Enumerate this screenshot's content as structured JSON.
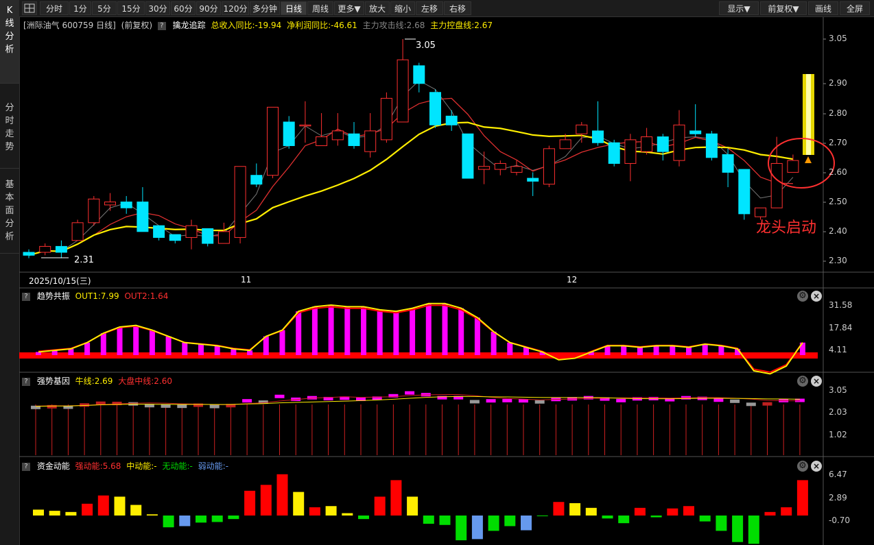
{
  "sidebar": {
    "tabs": [
      "K\n线\n分\n析",
      "分\n时\n走\n势",
      "基\n本\n面\n分\n析"
    ]
  },
  "toolbar": {
    "left": [
      "分时",
      "1分",
      "5分",
      "15分",
      "30分",
      "60分",
      "90分",
      "120分",
      "多分钟",
      "日线",
      "周线",
      "更多▼",
      "放大",
      "缩小",
      "左移",
      "右移"
    ],
    "right": [
      "显示▼",
      "前复权▼",
      "画线",
      "全屏"
    ],
    "active": "日线"
  },
  "main": {
    "stock": "[洲际油气 600759 日线]",
    "adjust": "(前复权)",
    "indicator": "擒龙追踪",
    "rev": "总收入同比:-19.94",
    "profit": "净利润同比:-46.61",
    "attack": "主力攻击线:2.68",
    "control": "主力控盘线:2.67",
    "y_labels": [
      "3.05",
      "2.90",
      "2.80",
      "2.70",
      "2.60",
      "2.50",
      "2.40",
      "2.30"
    ],
    "x_labels": [
      "2025/10/15(三)",
      "11",
      "12"
    ],
    "high_label": "3.05",
    "low_label": "2.31",
    "annotation": "龙头启动"
  },
  "trend": {
    "name": "趋势共振",
    "out1": "OUT1:7.99",
    "out2": "OUT2:1.64",
    "y_labels": [
      "31.58",
      "17.84",
      "4.11"
    ]
  },
  "gene": {
    "name": "强势基因",
    "bull": "牛线:2.69",
    "market": "大盘中线:2.60",
    "y_labels": [
      "3.05",
      "2.03",
      "1.02"
    ]
  },
  "fund": {
    "name": "资金动能",
    "strong": "强动能:5.68",
    "mid": "中动能:-",
    "none": "无动能:-",
    "weak": "弱动能:-",
    "y_labels": [
      "6.47",
      "2.89",
      "-0.70"
    ]
  },
  "colors": {
    "up": "#ff3030",
    "down": "#00e5ff",
    "ma_fast": "#e03030",
    "ma_slow": "#ffee00",
    "magenta": "#ff00ff",
    "red": "#ff0000",
    "yellow": "#ffee00",
    "green": "#00dd00",
    "blue": "#6699ee"
  },
  "chart_data": {
    "type": "candlestick",
    "ylim": [
      2.28,
      3.09
    ],
    "candles": [
      [
        2.33,
        2.32,
        2.34,
        2.31
      ],
      [
        2.33,
        2.35,
        2.36,
        2.32
      ],
      [
        2.35,
        2.33,
        2.37,
        2.31
      ],
      [
        2.37,
        2.43,
        2.44,
        2.37
      ],
      [
        2.43,
        2.51,
        2.52,
        2.42
      ],
      [
        2.49,
        2.5,
        2.53,
        2.47
      ],
      [
        2.5,
        2.48,
        2.52,
        2.46
      ],
      [
        2.5,
        2.4,
        2.55,
        2.4
      ],
      [
        2.42,
        2.38,
        2.42,
        2.37
      ],
      [
        2.39,
        2.37,
        2.39,
        2.36
      ],
      [
        2.38,
        2.42,
        2.44,
        2.34
      ],
      [
        2.41,
        2.36,
        2.41,
        2.35
      ],
      [
        2.36,
        2.4,
        2.43,
        2.36
      ],
      [
        2.38,
        2.62,
        2.62,
        2.36
      ],
      [
        2.59,
        2.56,
        2.63,
        2.55
      ],
      [
        2.59,
        2.82,
        2.82,
        2.58
      ],
      [
        2.77,
        2.69,
        2.79,
        2.68
      ],
      [
        2.76,
        2.76,
        2.84,
        2.7
      ],
      [
        2.69,
        2.72,
        2.8,
        2.69
      ],
      [
        2.71,
        2.74,
        2.8,
        2.69
      ],
      [
        2.73,
        2.69,
        2.77,
        2.68
      ],
      [
        2.67,
        2.74,
        2.8,
        2.65
      ],
      [
        2.71,
        2.85,
        2.87,
        2.7
      ],
      [
        2.77,
        2.98,
        3.05,
        2.77
      ],
      [
        2.96,
        2.9,
        2.97,
        2.87
      ],
      [
        2.87,
        2.76,
        2.88,
        2.75
      ],
      [
        2.79,
        2.76,
        2.81,
        2.74
      ],
      [
        2.73,
        2.58,
        2.73,
        2.58
      ],
      [
        2.61,
        2.62,
        2.67,
        2.56
      ],
      [
        2.61,
        2.63,
        2.64,
        2.59
      ],
      [
        2.6,
        2.62,
        2.64,
        2.59
      ],
      [
        2.58,
        2.57,
        2.6,
        2.52
      ],
      [
        2.56,
        2.68,
        2.69,
        2.55
      ],
      [
        2.68,
        2.71,
        2.73,
        2.68
      ],
      [
        2.73,
        2.76,
        2.77,
        2.7
      ],
      [
        2.74,
        2.7,
        2.84,
        2.69
      ],
      [
        2.7,
        2.63,
        2.71,
        2.62
      ],
      [
        2.63,
        2.71,
        2.73,
        2.57
      ],
      [
        2.67,
        2.72,
        2.75,
        2.66
      ],
      [
        2.72,
        2.67,
        2.73,
        2.64
      ],
      [
        2.64,
        2.76,
        2.81,
        2.62
      ],
      [
        2.74,
        2.73,
        2.83,
        2.72
      ],
      [
        2.73,
        2.65,
        2.74,
        2.64
      ],
      [
        2.66,
        2.6,
        2.68,
        2.55
      ],
      [
        2.61,
        2.46,
        2.61,
        2.44
      ],
      [
        2.45,
        2.48,
        2.48,
        2.44
      ],
      [
        2.48,
        2.63,
        2.72,
        2.48
      ],
      [
        2.6,
        2.64,
        2.66,
        2.6
      ]
    ]
  }
}
